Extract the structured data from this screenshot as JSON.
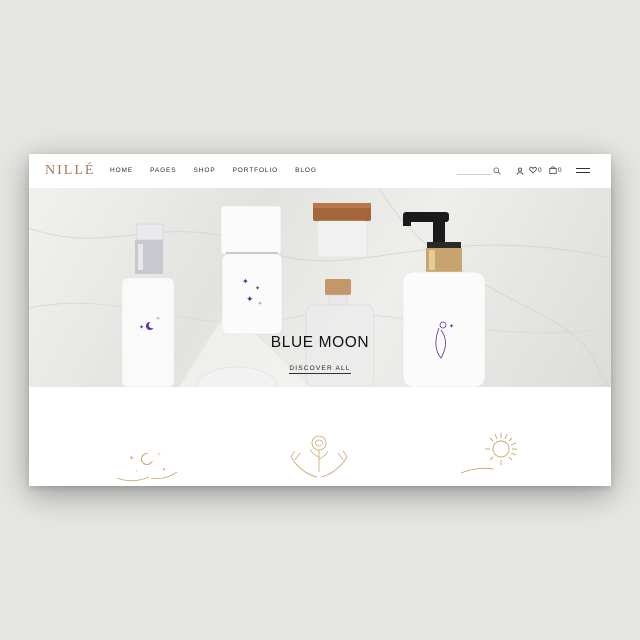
{
  "header": {
    "logo": "NILLÉ",
    "nav": [
      "HOME",
      "PAGES",
      "SHOP",
      "PORTFOLIO",
      "BLOG"
    ],
    "wishlist_count": "0",
    "cart_count": "0"
  },
  "hero": {
    "title": "BLUE MOON",
    "cta": "DISCOVER ALL"
  },
  "icons": {
    "search": "search-icon",
    "account": "user-icon",
    "wishlist": "heart-icon",
    "cart": "shopping-bag-icon",
    "menu": "hamburger-menu-icon"
  },
  "colors": {
    "background": "#e6e6e3",
    "logo": "#a07a58",
    "accent_purple": "#5b2a9e",
    "gold": "#c8a46e"
  }
}
